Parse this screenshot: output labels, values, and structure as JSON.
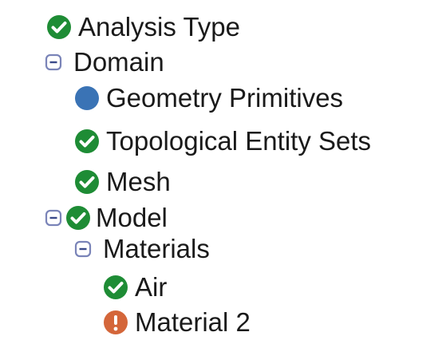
{
  "colors": {
    "check_green": "#1e8c35",
    "info_blue": "#3a73b5",
    "warning_orange": "#d4663a",
    "collapse_border": "#7a84b8",
    "collapse_fill": "#ffffff",
    "text": "#1a1a1a"
  },
  "tree": {
    "nodes": [
      {
        "label": "Analysis Type",
        "status_icon": "check-circle-icon",
        "expander": "none"
      },
      {
        "label": "Domain",
        "status_icon": "none",
        "expander": "collapse-icon"
      },
      {
        "label": "Geometry Primitives",
        "status_icon": "blue-dot-icon",
        "expander": "none"
      },
      {
        "label": "Topological Entity Sets",
        "status_icon": "check-circle-icon",
        "expander": "none"
      },
      {
        "label": "Mesh",
        "status_icon": "check-circle-icon",
        "expander": "none"
      },
      {
        "label": "Model",
        "status_icon": "check-circle-icon",
        "expander": "collapse-icon"
      },
      {
        "label": "Materials",
        "status_icon": "none",
        "expander": "collapse-icon"
      },
      {
        "label": "Air",
        "status_icon": "check-circle-icon",
        "expander": "none"
      },
      {
        "label": "Material 2",
        "status_icon": "warning-circle-icon",
        "expander": "none"
      }
    ]
  }
}
